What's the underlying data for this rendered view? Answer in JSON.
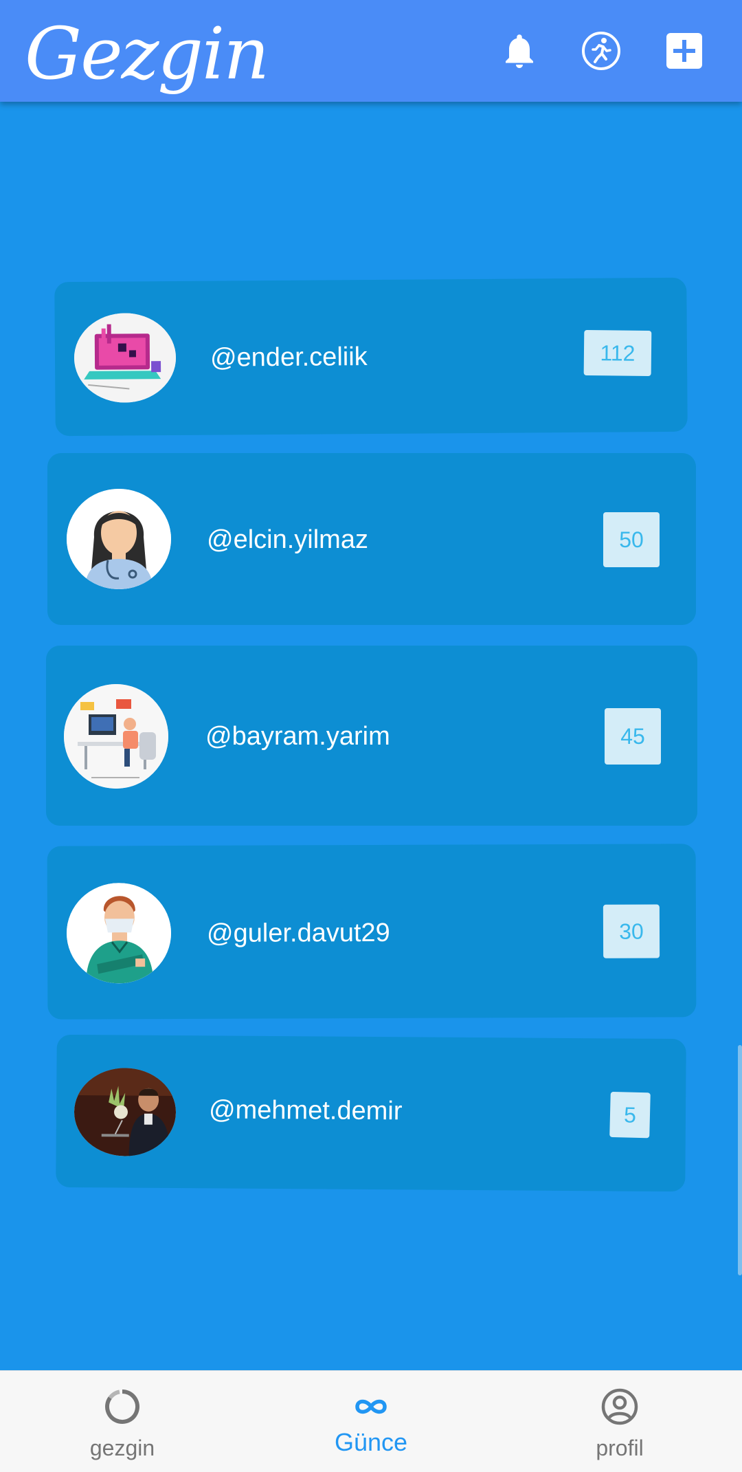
{
  "app": {
    "title": "Gezgin"
  },
  "leaderboard": [
    {
      "username": "@ender.celiik",
      "score": "112",
      "avatar": "laptop-illustration-avatar"
    },
    {
      "username": "@elcin.yilmaz",
      "score": "50",
      "avatar": "doctor-woman-avatar"
    },
    {
      "username": "@bayram.yarim",
      "score": "45",
      "avatar": "developer-desk-avatar"
    },
    {
      "username": "@guler.davut29",
      "score": "30",
      "avatar": "nurse-man-avatar"
    },
    {
      "username": "@mehmet.demir",
      "score": "5",
      "avatar": "speaker-photo-avatar"
    }
  ],
  "bottom_nav": {
    "items": [
      {
        "label": "gezgin",
        "icon": "circle-loader-icon",
        "active": false
      },
      {
        "label": "Günce",
        "icon": "infinity-icon",
        "active": true
      },
      {
        "label": "profil",
        "icon": "account-circle-icon",
        "active": false
      }
    ]
  },
  "colors": {
    "appbar": "#4a8cf7",
    "background": "#1a94eb",
    "card": "#0d8ed3",
    "score_badge": "#d4edf8",
    "score_text": "#39b8ec",
    "nav_active": "#2196f3",
    "nav_inactive": "#757575"
  }
}
